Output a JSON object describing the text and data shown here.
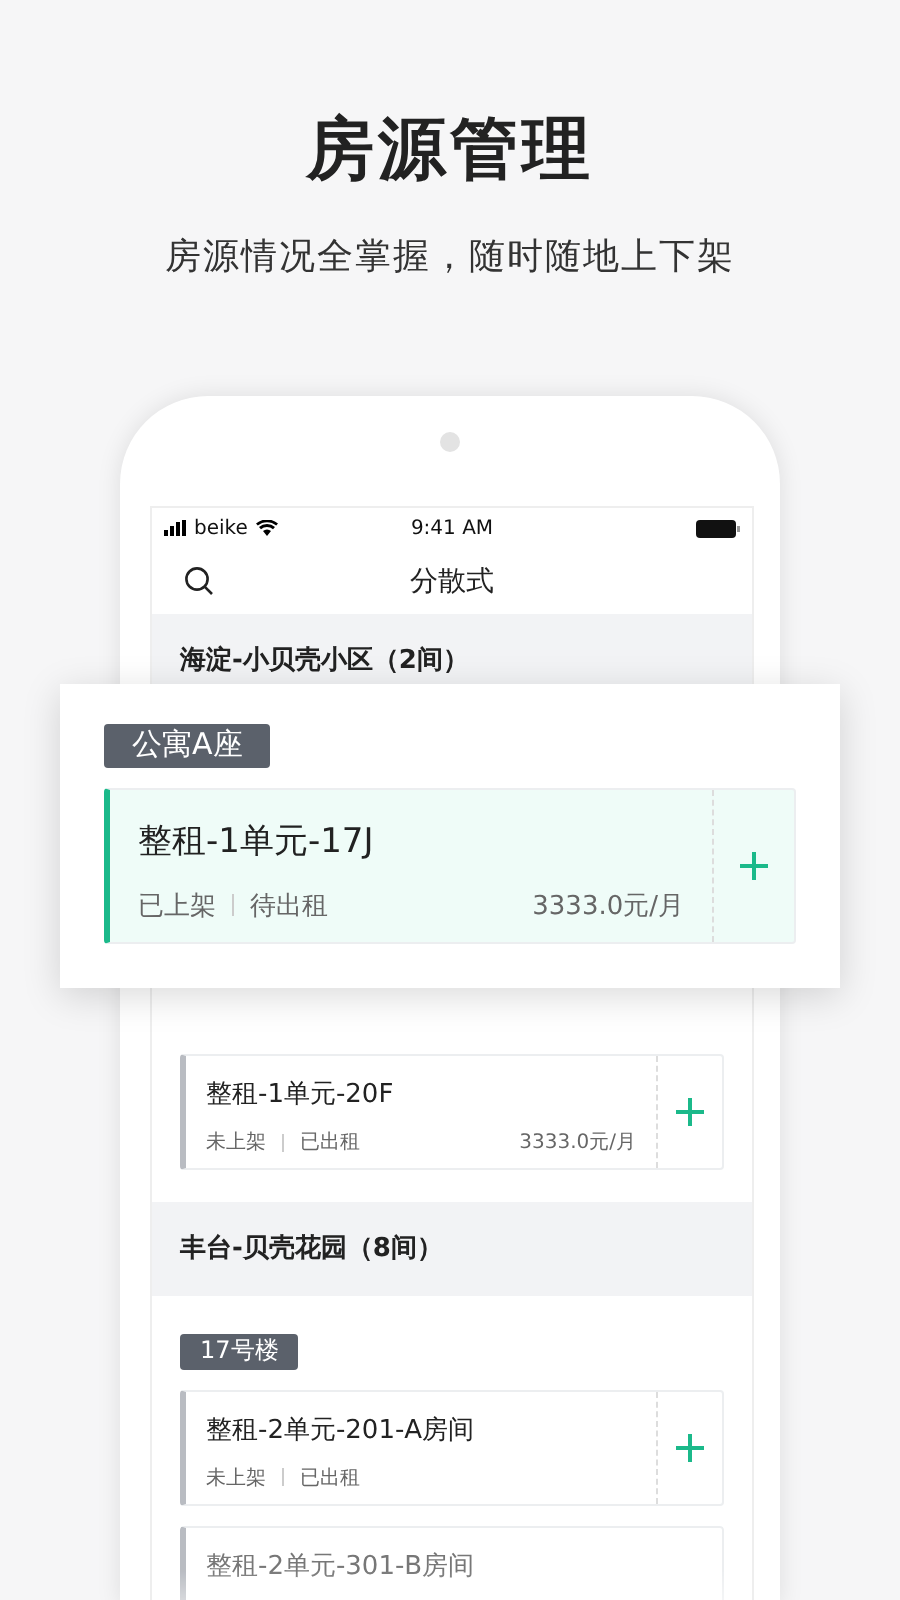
{
  "header": {
    "title": "房源管理",
    "subtitle": "房源情况全掌握，随时随地上下架"
  },
  "status_bar": {
    "carrier": "beike",
    "time": "9:41 AM"
  },
  "nav": {
    "title": "分散式"
  },
  "groups": [
    {
      "name": "海淀-小贝壳小区（2间）",
      "buildings": [
        {
          "tag": "公寓A座",
          "raised": true,
          "units": [
            {
              "name": "整租-1单元-17J",
              "listing": "已上架",
              "rental": "待出租",
              "price": "3333.0元/月",
              "listed": true,
              "raised": true,
              "faded": false
            },
            {
              "name": "整租-1单元-20F",
              "listing": "未上架",
              "rental": "已出租",
              "price": "3333.0元/月",
              "listed": false,
              "raised": false,
              "faded": false
            }
          ]
        }
      ]
    },
    {
      "name": "丰台-贝壳花园（8间）",
      "buildings": [
        {
          "tag": "17号楼",
          "raised": false,
          "units": [
            {
              "name": "整租-2单元-201-A房间",
              "listing": "未上架",
              "rental": "已出租",
              "listed": false,
              "raised": false,
              "faded": false
            },
            {
              "name": "整租-2单元-301-B房间",
              "listed": false,
              "raised": false,
              "faded": true
            }
          ]
        }
      ]
    }
  ]
}
